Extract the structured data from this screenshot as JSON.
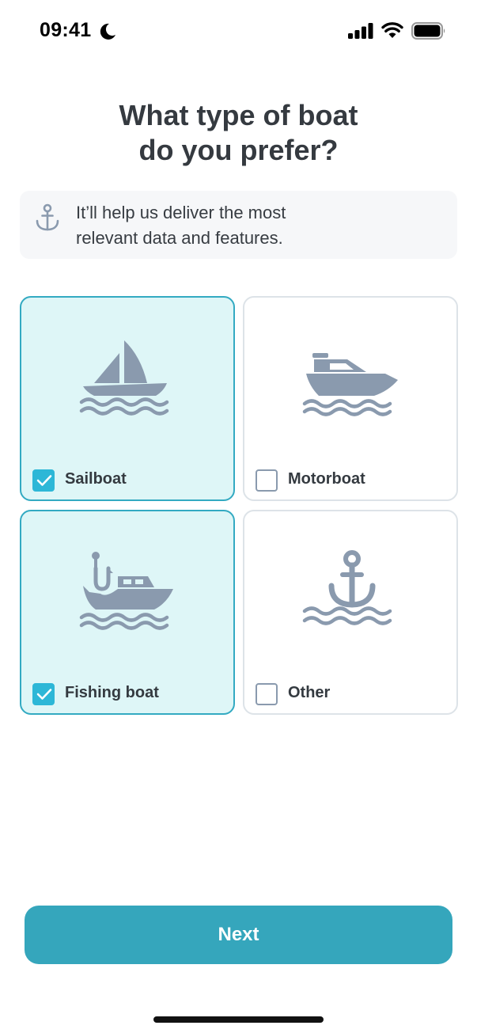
{
  "status_bar": {
    "time": "09:41",
    "icons": [
      "moon-icon",
      "signal-icon",
      "wifi-icon",
      "battery-icon"
    ]
  },
  "title": {
    "line1": "What type of boat",
    "line2": "do you prefer?"
  },
  "info": {
    "icon": "anchor-icon",
    "line1": "It’ll help us deliver the most",
    "line2": "relevant data and features."
  },
  "options": [
    {
      "label": "Sailboat",
      "icon": "sailboat-icon",
      "checked": true
    },
    {
      "label": "Motorboat",
      "icon": "motorboat-icon",
      "checked": false
    },
    {
      "label": "Fishing boat",
      "icon": "fishing-boat-icon",
      "checked": true
    },
    {
      "label": "Other",
      "icon": "anchor-waves-icon",
      "checked": false
    }
  ],
  "next_button": {
    "label": "Next"
  },
  "colors": {
    "accent": "#35a6bc",
    "checkbox_checked": "#2db7d7",
    "selected_card_bg": "#def6f7",
    "selected_card_border": "#33aac2",
    "icon_gray": "#8a9aae"
  }
}
